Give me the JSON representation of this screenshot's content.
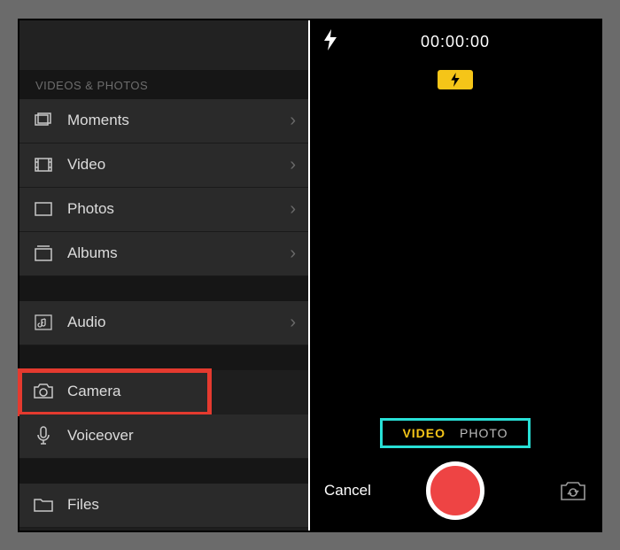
{
  "left": {
    "section_label": "VIDEOS & PHOTOS",
    "items": {
      "moments": "Moments",
      "video": "Video",
      "photos": "Photos",
      "albums": "Albums",
      "audio": "Audio",
      "camera": "Camera",
      "voiceover": "Voiceover",
      "files": "Files"
    }
  },
  "camera": {
    "timer": "00:00:00",
    "modes": {
      "video": "VIDEO",
      "photo": "PHOTO"
    },
    "cancel": "Cancel"
  }
}
